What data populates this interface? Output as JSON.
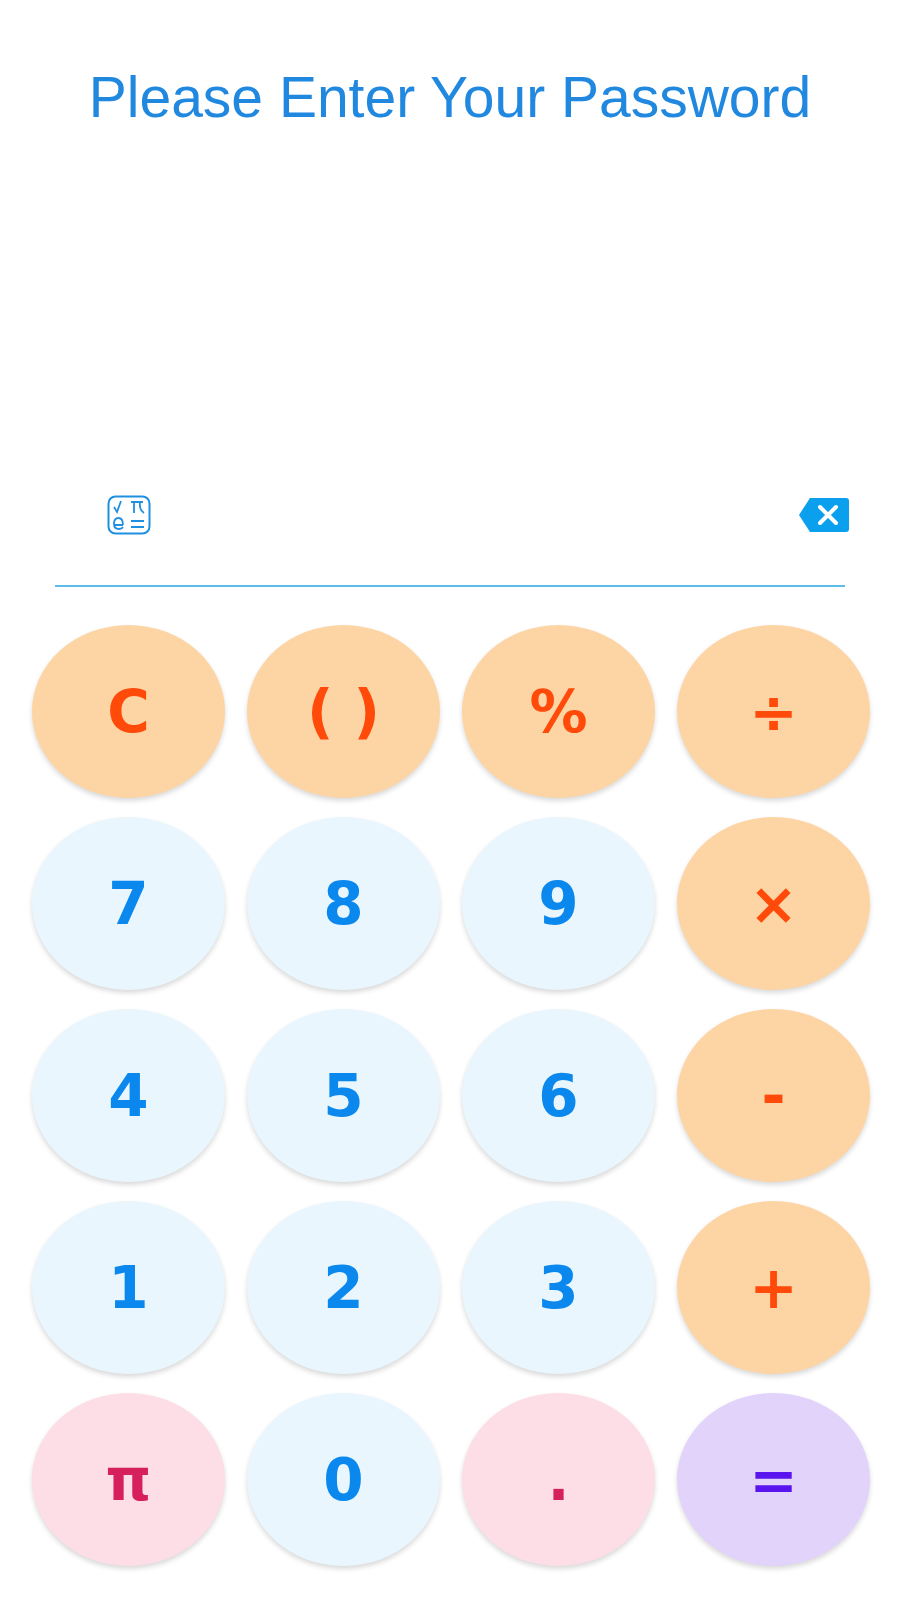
{
  "title": "Please Enter Your Password",
  "keys": [
    {
      "label": "C",
      "kind": "operator"
    },
    {
      "label": "( )",
      "kind": "operator"
    },
    {
      "label": "%",
      "kind": "operator"
    },
    {
      "label": "÷",
      "kind": "operator"
    },
    {
      "label": "7",
      "kind": "digit"
    },
    {
      "label": "8",
      "kind": "digit"
    },
    {
      "label": "9",
      "kind": "digit"
    },
    {
      "label": "×",
      "kind": "operator"
    },
    {
      "label": "4",
      "kind": "digit"
    },
    {
      "label": "5",
      "kind": "digit"
    },
    {
      "label": "6",
      "kind": "digit"
    },
    {
      "label": "-",
      "kind": "operator"
    },
    {
      "label": "1",
      "kind": "digit"
    },
    {
      "label": "2",
      "kind": "digit"
    },
    {
      "label": "3",
      "kind": "digit"
    },
    {
      "label": "+",
      "kind": "operator"
    },
    {
      "label": "π",
      "kind": "constant"
    },
    {
      "label": "0",
      "kind": "digit"
    },
    {
      "label": ".",
      "kind": "constant"
    },
    {
      "label": "=",
      "kind": "equals"
    }
  ]
}
